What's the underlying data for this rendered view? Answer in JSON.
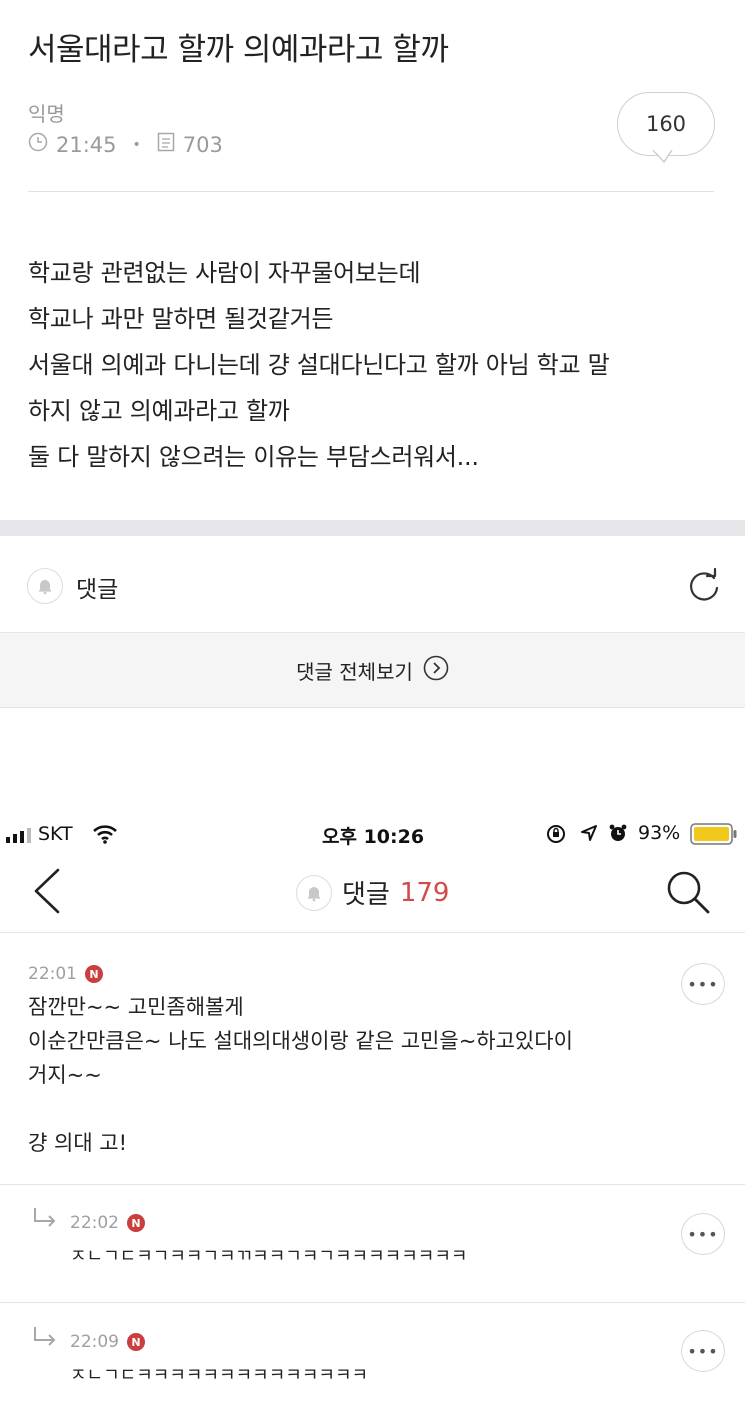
{
  "post": {
    "title": "서울대라고 할까 의예과라고 할까",
    "author": "익명",
    "time": "21:45",
    "views": "703",
    "comment_count": "160",
    "body_lines": [
      "학교랑 관련없는 사람이 자꾸물어보는데",
      "학교나 과만 말하면 될것같거든",
      "서울대 의예과 다니는데 걍 설대다닌다고 할까 아님 학교 말",
      "하지 않고 의예과라고 할까",
      "둘 다 말하지 않으려는 이유는 부담스러워서..."
    ]
  },
  "comments_section": {
    "label": "댓글",
    "view_all": "댓글 전체보기"
  },
  "status_bar": {
    "carrier": "SKT",
    "time": "오후 10:26",
    "battery": "93%"
  },
  "comments_page": {
    "title": "댓글",
    "count": "179",
    "badge": "N",
    "comments": [
      {
        "time": "22:01",
        "lines": [
          "잠깐만~~ 고민좀해볼게",
          "이순간만큼은~ 나도 설대의대생이랑 같은 고민을~하고있다이",
          "거지~~",
          "",
          "걍 의대 고!"
        ]
      },
      {
        "time": "22:02",
        "lines": [
          "ㅈㄴㄱㄷㅋㄱㅋㅋㄱㅋㄲㅋㅋㄱㅋㄱㅋㅋㅋㅋㅋㅋㅋㅋ"
        ]
      },
      {
        "time": "22:09",
        "lines": [
          "ㅈㄴㄱㄷㅋㅋㅋㅋㅋㅋㅋㅋㅋㅋㅋㅋㅋㅋ"
        ]
      }
    ],
    "more_label": "•••"
  }
}
